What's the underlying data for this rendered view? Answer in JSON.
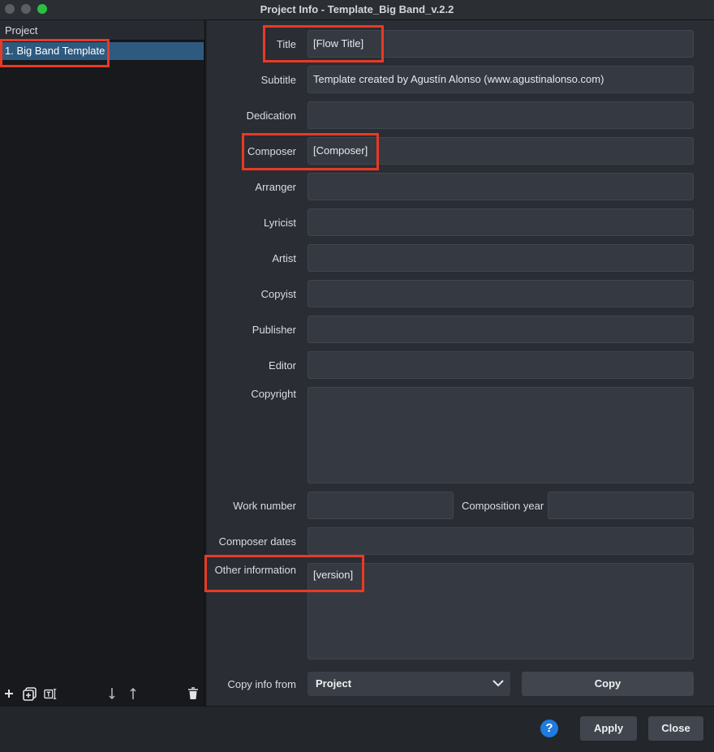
{
  "window": {
    "title": "Project Info - Template_Big Band_v.2.2"
  },
  "sidebar": {
    "header": "Project",
    "items": [
      {
        "label": "1. Big Band Template"
      }
    ],
    "toolbar": {
      "add_icon": "plus-icon",
      "duplicate_icon": "duplicate-icon",
      "rename_icon": "rename-icon",
      "move_down_icon": "move-down-icon",
      "move_up_icon": "move-up-icon",
      "delete_icon": "trash-icon"
    }
  },
  "fields": {
    "title": {
      "label": "Title",
      "value": "[Flow Title]"
    },
    "subtitle": {
      "label": "Subtitle",
      "value": "Template created by Agustín Alonso (www.agustinalonso.com)"
    },
    "dedication": {
      "label": "Dedication",
      "value": ""
    },
    "composer": {
      "label": "Composer",
      "value": "[Composer]"
    },
    "arranger": {
      "label": "Arranger",
      "value": ""
    },
    "lyricist": {
      "label": "Lyricist",
      "value": ""
    },
    "artist": {
      "label": "Artist",
      "value": ""
    },
    "copyist": {
      "label": "Copyist",
      "value": ""
    },
    "publisher": {
      "label": "Publisher",
      "value": ""
    },
    "editor": {
      "label": "Editor",
      "value": ""
    },
    "copyright": {
      "label": "Copyright",
      "value": ""
    },
    "work_number": {
      "label": "Work number",
      "value": ""
    },
    "composition_year": {
      "label": "Composition year",
      "value": ""
    },
    "composer_dates": {
      "label": "Composer dates",
      "value": ""
    },
    "other_information": {
      "label": "Other information",
      "value": "[version]"
    }
  },
  "copy_info": {
    "label": "Copy info from",
    "selected": "Project",
    "button": "Copy"
  },
  "footer": {
    "help": "?",
    "apply": "Apply",
    "close": "Close"
  },
  "colors": {
    "highlight": "#e83a25",
    "selection": "#2f5a80",
    "help": "#1e7be0"
  }
}
